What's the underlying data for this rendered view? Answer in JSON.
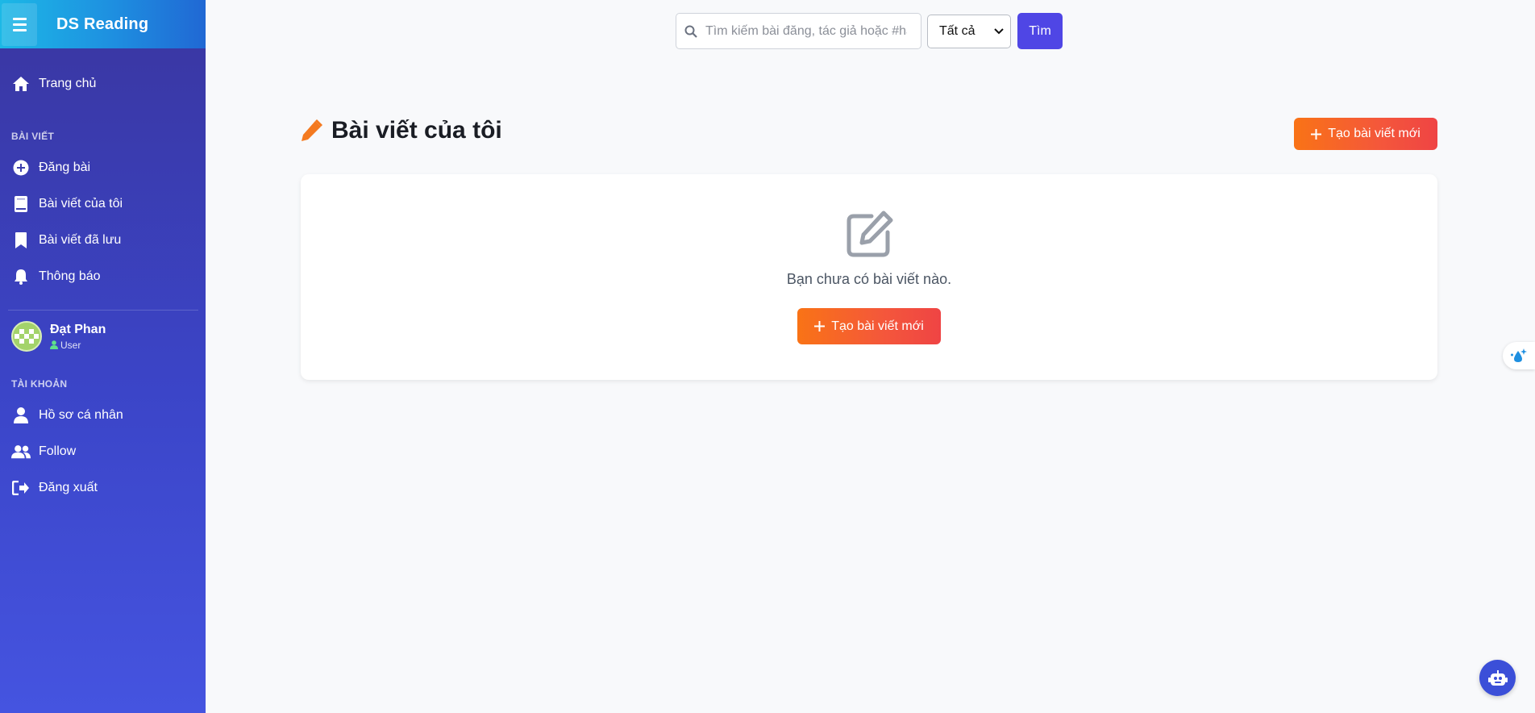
{
  "app": {
    "brand": "DS Reading"
  },
  "sidebar": {
    "home": "Trang chủ",
    "section_posts": "BÀI VIẾT",
    "posts_items": [
      {
        "label": "Đăng bài",
        "icon": "plus-circle-icon"
      },
      {
        "label": "Bài viết của tôi",
        "icon": "book-icon"
      },
      {
        "label": "Bài viết đã lưu",
        "icon": "bookmark-icon"
      },
      {
        "label": "Thông báo",
        "icon": "bell-icon"
      }
    ],
    "user": {
      "name": "Đạt Phan",
      "role": "User"
    },
    "section_account": "TÀI KHOẢN",
    "account_items": [
      {
        "label": "Hồ sơ cá nhân",
        "icon": "user-icon"
      },
      {
        "label": "Follow",
        "icon": "users-icon"
      },
      {
        "label": "Đăng xuất",
        "icon": "logout-icon"
      }
    ]
  },
  "search": {
    "placeholder": "Tìm kiếm bài đăng, tác giả hoặc #hashtag",
    "filter_selected": "Tất cả",
    "button": "Tìm"
  },
  "main": {
    "title": "Bài viết của tôi",
    "new_post_button": "Tạo bài viết mới",
    "empty_message": "Bạn chưa có bài viết nào.",
    "empty_button": "Tạo bài viết mới"
  },
  "colors": {
    "sidebar_top": "#3a36a0",
    "sidebar_bottom": "#4554e0",
    "accent_orange": "#f97316",
    "accent_red": "#ef4444",
    "search_button": "#4f46e5"
  }
}
